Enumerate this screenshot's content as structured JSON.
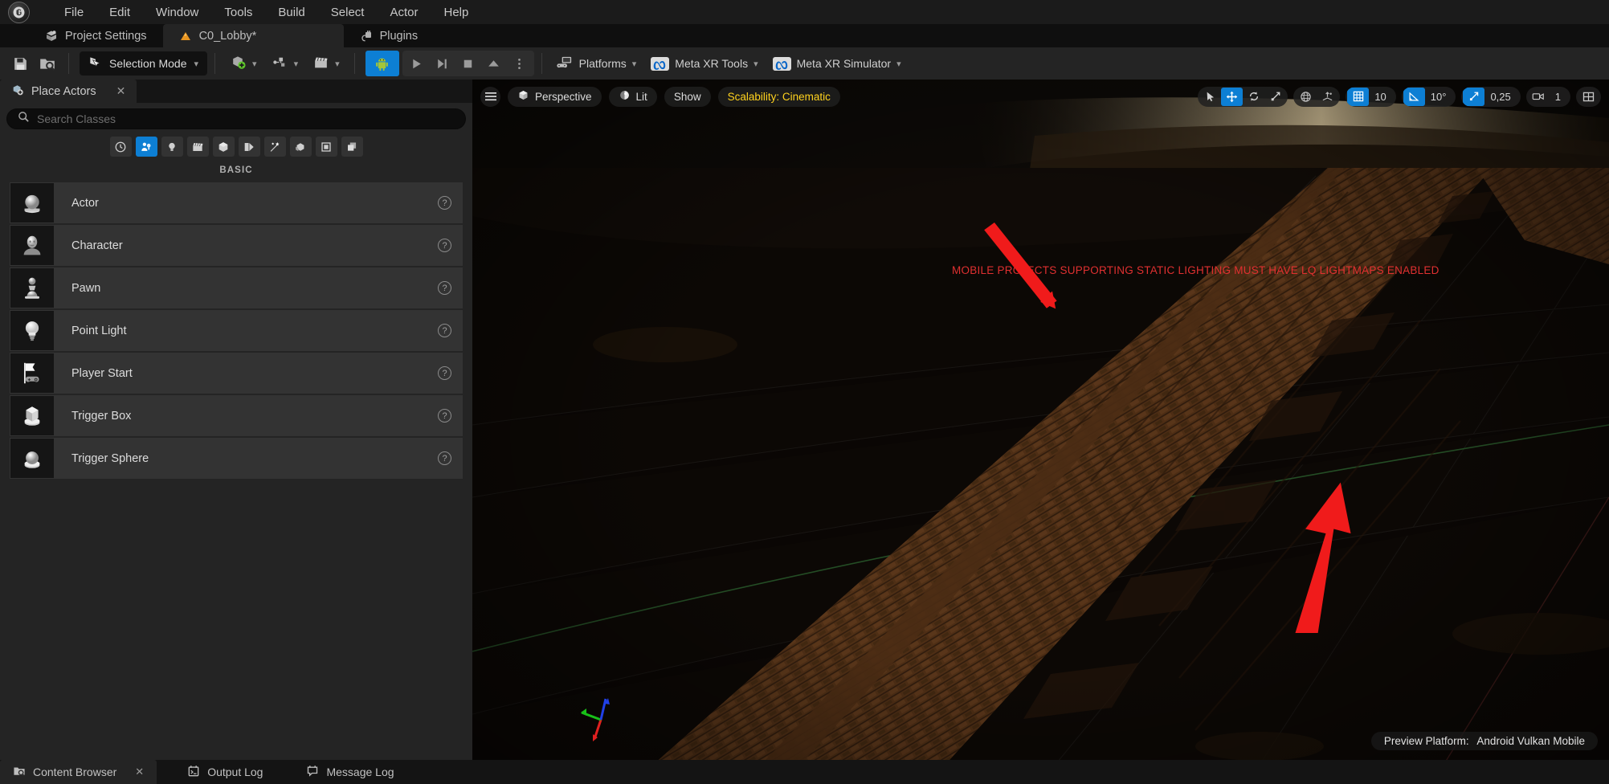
{
  "app": {
    "logo_icon": "unreal-engine-logo",
    "menu": [
      {
        "label": "File"
      },
      {
        "label": "Edit"
      },
      {
        "label": "Window"
      },
      {
        "label": "Tools"
      },
      {
        "label": "Build"
      },
      {
        "label": "Select"
      },
      {
        "label": "Actor"
      },
      {
        "label": "Help"
      }
    ]
  },
  "tabs": [
    {
      "label": "Project Settings",
      "icon": "project-settings-icon",
      "active": false,
      "modified": false
    },
    {
      "label": "C0_Lobby*",
      "icon": "level-icon",
      "active": true,
      "modified": true
    },
    {
      "label": "Plugins",
      "icon": "plugins-icon",
      "active": false,
      "modified": false
    }
  ],
  "toolbar": {
    "save_icon": "save-icon",
    "browse_icon": "browse-content-icon",
    "mode_label": "Selection Mode",
    "mode_icon": "selection-mode-icon",
    "add_icon": "add-actor-icon",
    "blueprint_icon": "blueprints-icon",
    "cinematics_icon": "cinematics-icon",
    "platform_icon": "android-platform-icon",
    "play_icon": "play-icon",
    "skip_icon": "step-icon",
    "stop_icon": "stop-icon",
    "eject_icon": "eject-icon",
    "more_icon": "more-options-icon",
    "right_items": [
      {
        "label": "Platforms",
        "icon": "platforms-icon"
      },
      {
        "label": "Meta XR Tools",
        "icon": "meta-icon"
      },
      {
        "label": "Meta XR Simulator",
        "icon": "meta-icon"
      }
    ]
  },
  "place_actors": {
    "tab_label": "Place Actors",
    "tab_icon": "place-actors-icon",
    "close_icon": "close-icon",
    "search": {
      "value": "",
      "placeholder": "Search Classes",
      "icon": "search-icon"
    },
    "categories": [
      {
        "name": "recently-placed",
        "icon": "clock-icon",
        "active": false
      },
      {
        "name": "basic",
        "icon": "basic-shapes-icon",
        "active": true
      },
      {
        "name": "lights",
        "icon": "light-bulb-icon",
        "active": false
      },
      {
        "name": "cinematic",
        "icon": "clapperboard-icon",
        "active": false
      },
      {
        "name": "shapes",
        "icon": "cube-icon",
        "active": false
      },
      {
        "name": "visual-effects",
        "icon": "visual-effects-icon",
        "active": false
      },
      {
        "name": "volumes",
        "icon": "magic-wand-icon",
        "active": false
      },
      {
        "name": "all-classes",
        "icon": "layers-icon",
        "active": false
      },
      {
        "name": "geometry",
        "icon": "square-icon",
        "active": false
      },
      {
        "name": "stacked",
        "icon": "stacked-icon",
        "active": false
      }
    ],
    "section_label": "BASIC",
    "items": [
      {
        "label": "Actor",
        "icon": "actor-sphere-icon",
        "help_icon": "help-icon"
      },
      {
        "label": "Character",
        "icon": "character-icon",
        "help_icon": "help-icon"
      },
      {
        "label": "Pawn",
        "icon": "pawn-icon",
        "help_icon": "help-icon"
      },
      {
        "label": "Point Light",
        "icon": "point-light-icon",
        "help_icon": "help-icon"
      },
      {
        "label": "Player Start",
        "icon": "player-start-icon",
        "help_icon": "help-icon"
      },
      {
        "label": "Trigger Box",
        "icon": "trigger-box-icon",
        "help_icon": "help-icon"
      },
      {
        "label": "Trigger Sphere",
        "icon": "trigger-sphere-icon",
        "help_icon": "help-icon"
      }
    ]
  },
  "viewport": {
    "menu_icon": "viewport-menu-icon",
    "camera_mode": "Perspective",
    "camera_icon": "perspective-cube-icon",
    "view_mode": "Lit",
    "view_mode_icon": "lit-sphere-icon",
    "show_label": "Show",
    "scalability": "Scalability: Cinematic",
    "scalability_color": "#ffd21e",
    "warning_text": "MOBILE PROJECTS SUPPORTING STATIC LIGHTING MUST HAVE LQ LIGHTMAPS ENABLED",
    "warning_color": "#e03030",
    "preview_platform_label": "Preview Platform:",
    "preview_platform_value": "Android Vulkan Mobile",
    "transform_tools": [
      {
        "name": "select-tool",
        "icon": "cursor-arrow-icon",
        "active": false
      },
      {
        "name": "move-tool",
        "icon": "move-arrows-icon",
        "active": true
      },
      {
        "name": "rotate-tool",
        "icon": "rotate-icon",
        "active": false
      },
      {
        "name": "scale-tool",
        "icon": "scale-icon",
        "active": false
      }
    ],
    "coord_tools": [
      {
        "name": "world-coordinate-toggle",
        "icon": "globe-icon",
        "active": false
      },
      {
        "name": "surface-snap-toggle",
        "icon": "surface-snap-icon",
        "active": false
      }
    ],
    "snap_grid": {
      "icon": "grid-snap-icon",
      "value": "10",
      "active": true
    },
    "snap_angle": {
      "icon": "angle-snap-icon",
      "value": "10°",
      "active": true
    },
    "snap_scale": {
      "icon": "scale-snap-icon",
      "value": "0,25",
      "active": true
    },
    "camera_speed": {
      "icon": "camera-speed-icon",
      "value": "1",
      "active": false
    },
    "layout": {
      "icon": "viewport-layout-icon",
      "active": false
    },
    "gizmo_axes": [
      "X",
      "Y",
      "Z"
    ]
  },
  "status_tabs": [
    {
      "label": "Content Browser",
      "icon": "content-browser-icon",
      "active": true,
      "closable": true,
      "close_icon": "close-icon"
    },
    {
      "label": "Output Log",
      "icon": "output-log-icon",
      "active": false,
      "closable": false
    },
    {
      "label": "Message Log",
      "icon": "message-log-icon",
      "active": false,
      "closable": false
    }
  ]
}
